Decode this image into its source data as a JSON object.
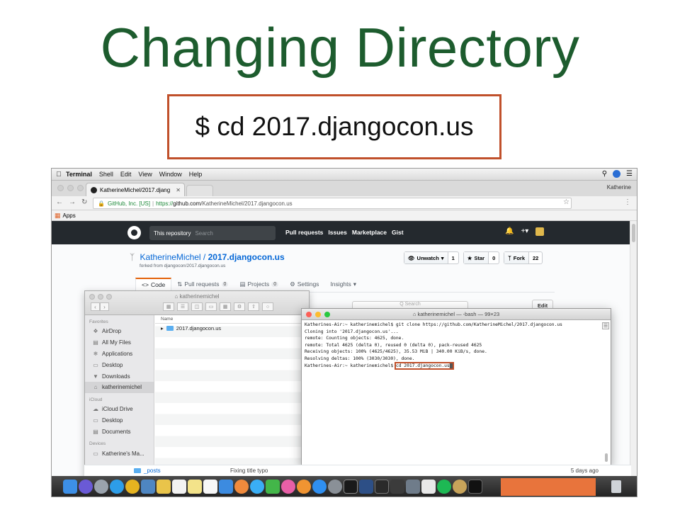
{
  "slide": {
    "title": "Changing Directory",
    "command": "$ cd 2017.djangocon.us"
  },
  "menubar": {
    "app": "Terminal",
    "items": [
      "Shell",
      "Edit",
      "View",
      "Window",
      "Help"
    ]
  },
  "browser": {
    "tab_title": "KatherineMichel/2017.djang",
    "profile": "Katherine",
    "secure_label": "GitHub, Inc. [US]",
    "url_scheme": "https://",
    "url_host": "github.com",
    "url_path": "/KatherineMichel/2017.djangocon.us",
    "bookmarks_label": "Apps"
  },
  "github": {
    "search_scope": "This repository",
    "search_placeholder": "Search",
    "nav": [
      "Pull requests",
      "Issues",
      "Marketplace",
      "Gist"
    ],
    "repo_owner": "KatherineMichel",
    "repo_sep": " / ",
    "repo_name": "2017.djangocon.us",
    "forked_from": "forked from djangocon/2017.djangocon.us",
    "watch_label": "Unwatch",
    "watch_count": "1",
    "star_label": "Star",
    "star_count": "0",
    "fork_label": "Fork",
    "fork_count": "22",
    "tabs": [
      {
        "label": "Code",
        "count": ""
      },
      {
        "label": "Pull requests",
        "count": "0"
      },
      {
        "label": "Projects",
        "count": "0"
      },
      {
        "label": "Settings",
        "count": ""
      },
      {
        "label": "Insights",
        "count": ""
      }
    ],
    "search_ph2": "Q Search",
    "edit_label": "Edit",
    "commit_folder": "_posts",
    "commit_msg": "Fixing title typo",
    "commit_date": "5 days ago"
  },
  "finder": {
    "title": "katherinemichel",
    "favorites_header": "Favorites",
    "favorites": [
      "AirDrop",
      "All My Files",
      "Applications",
      "Desktop",
      "Downloads",
      "katherinemichel"
    ],
    "icloud_header": "iCloud",
    "icloud": [
      "iCloud Drive",
      "Desktop",
      "Documents"
    ],
    "devices_header": "Devices",
    "devices": [
      "Katherine's Ma..."
    ],
    "column_name": "Name",
    "rows": [
      "2017.djangocon.us"
    ]
  },
  "terminal": {
    "title": "katherinemichel — -bash — 99×23",
    "lines": [
      "Katherines-Air:~ katherinemichel$ git clone https://github.com/KatherineMichel/2017.djangocon.us",
      "Cloning into '2017.djangocon.us'...",
      "remote: Counting objects: 4625, done.",
      "remote: Total 4625 (delta 0), reused 0 (delta 0), pack-reused 4625",
      "Receiving objects: 100% (4625/4625), 35.53 MiB | 340.00 KiB/s, done.",
      "Resolving deltas: 100% (3030/3030), done."
    ],
    "prompt": "Katherines-Air:~ katherinemichel$ ",
    "command": "cd 2017.djangocon.us"
  },
  "colors": {
    "title_green": "#1d5c2e",
    "highlight_red": "#c0502b",
    "github_dark": "#24292e",
    "link_blue": "#0366d6"
  }
}
